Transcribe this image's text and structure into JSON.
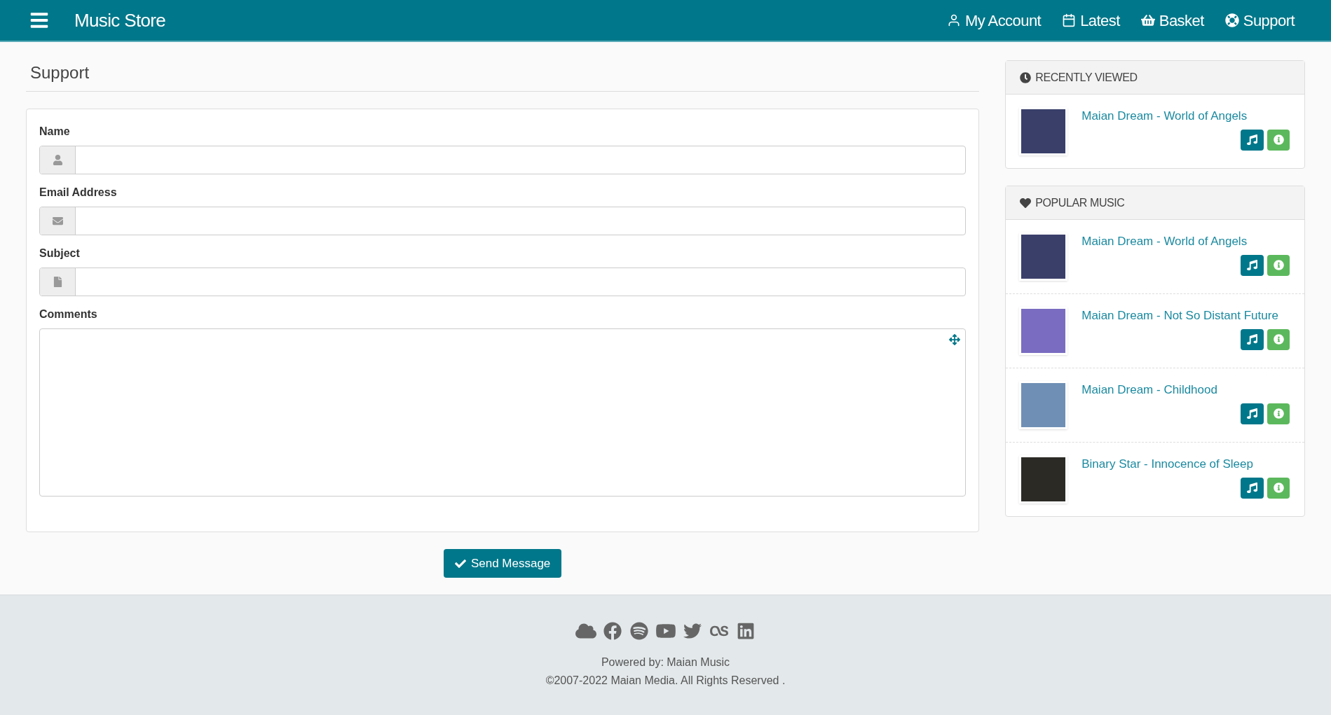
{
  "header": {
    "title": "Music Store",
    "nav": [
      {
        "kind": "account",
        "label": "My Account"
      },
      {
        "kind": "latest",
        "label": "Latest"
      },
      {
        "kind": "basket",
        "label": "Basket"
      },
      {
        "kind": "support",
        "label": "Support"
      }
    ]
  },
  "page_title": "Support",
  "form": {
    "fields": [
      {
        "kind": "name",
        "label": "Name"
      },
      {
        "kind": "email",
        "label": "Email Address"
      },
      {
        "kind": "subject",
        "label": "Subject"
      },
      {
        "kind": "comments",
        "label": "Comments"
      }
    ],
    "submit": "Send Message"
  },
  "sidebar": [
    {
      "kind": "recent",
      "title": "RECENTLY VIEWED",
      "items": [
        {
          "title": "Maian Dream - World of Angels"
        }
      ]
    },
    {
      "kind": "popular",
      "title": "POPULAR MUSIC",
      "items": [
        {
          "title": "Maian Dream - World of Angels"
        },
        {
          "title": "Maian Dream - Not So Distant Future"
        },
        {
          "title": "Maian Dream - Childhood"
        },
        {
          "title": "Binary Star - Innocence of Sleep"
        }
      ]
    }
  ],
  "footer": {
    "social": [
      {
        "kind": "soundcloud"
      },
      {
        "kind": "facebook"
      },
      {
        "kind": "spotify"
      },
      {
        "kind": "youtube"
      },
      {
        "kind": "twitter"
      },
      {
        "kind": "lastfm"
      },
      {
        "kind": "linkedin"
      }
    ],
    "powered_by": "Powered by: Maian Music",
    "copyright": "©2007-2022 Maian Media. All Rights Reserved ."
  }
}
